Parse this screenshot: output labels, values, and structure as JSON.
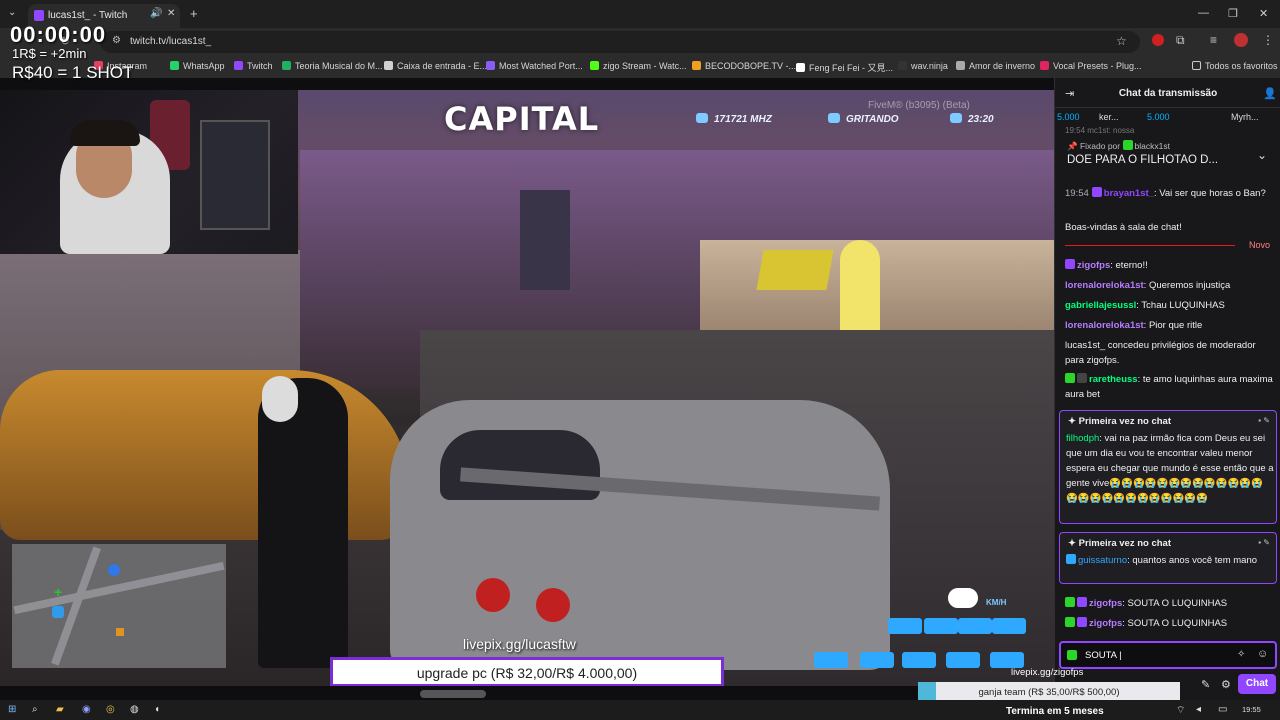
{
  "browser": {
    "tab_title": "lucas1st_ - Twitch",
    "tab_close": "✕",
    "new_tab": "+",
    "url": "twitch.tv/lucas1st_",
    "bookmarks": [
      {
        "label": "Instagram",
        "color": "#e4405f"
      },
      {
        "label": "WhatsApp",
        "color": "#25d366"
      },
      {
        "label": "Twitch",
        "color": "#9146ff"
      },
      {
        "label": "Teoria Musical do M...",
        "color": "#20b060"
      },
      {
        "label": "Caixa de entrada - E...",
        "color": "#d0d0d0"
      },
      {
        "label": "Most Watched Port...",
        "color": "#8a5cf6"
      },
      {
        "label": "zigo Stream - Watc...",
        "color": "#53fc18"
      },
      {
        "label": "BECODOBOPE.TV -...",
        "color": "#f0a020"
      },
      {
        "label": "Feng Fei Fei - 又見...",
        "color": "#ffffff"
      },
      {
        "label": "wav.ninja",
        "color": "#333333"
      },
      {
        "label": "Amor de inverno",
        "color": "#aaaaaa"
      },
      {
        "label": "Vocal Presets - Plug...",
        "color": "#e0245e"
      }
    ],
    "all_favorites": "Todos os favoritos"
  },
  "overlay": {
    "timer": "00:00:00",
    "rate_line1": "1R$ = +2min",
    "rate_line2": "R$40 = 1 SHOT"
  },
  "game": {
    "logo": "CAPITAL",
    "frequency": "171721 MHZ",
    "voice": "GRITANDO",
    "clock": "23:20",
    "fivem": "FiveM® (b3095) (Beta)",
    "speed_unit": "KM/H",
    "livepix": "livepix.gg/lucasftw",
    "goal": "upgrade pc (R$ 32,00/R$ 4.000,00)"
  },
  "chat": {
    "title": "Chat da transmissão",
    "leaderboard": [
      {
        "label": "5.000"
      },
      {
        "label": "ker..."
      },
      {
        "label": "5.000"
      },
      {
        "label": "Myrh..."
      }
    ],
    "behind_text": "19:54  mc1st: nossa",
    "pinned_by": "Fixado por",
    "pinned_user": "blackx1st",
    "pinned_text": "DOE PARA O FILHOTAO D...",
    "messages_top": [
      {
        "ts": "19:54",
        "user": "brayan1st_",
        "color": "#9147ff",
        "text": ": Vai ser que horas o Ban?"
      },
      {
        "ts": "",
        "user": "",
        "color": "#efeff1",
        "text": "Boas-vindas à sala de chat!"
      }
    ],
    "novo": "Novo",
    "messages": [
      {
        "user": "zigofps",
        "color": "#b77dff",
        "text": ": eterno!!"
      },
      {
        "user": "lorenalorelokа1st",
        "color": "#b77dff",
        "text": ": Queremos injustiça"
      },
      {
        "user": "gabriellajesussl",
        "color": "#00ff7f",
        "text": ": Tchau LUQUINHAS"
      },
      {
        "user": "lorenalorelokа1st",
        "color": "#b77dff",
        "text": ": Pior que ritle"
      },
      {
        "user": "",
        "color": "#efeff1",
        "text": "lucas1st_ concedeu privilégios de moderador para zigofps."
      },
      {
        "user": "raretheuss",
        "color": "#00ff7f",
        "text": ": te amo luquinhas aura maxima aura bet"
      }
    ],
    "first_title": "Primeira vez no chat",
    "first1_user": "filhodph",
    "first1_text": ": vai na paz irmão fica com Deus eu sei que um dia eu vou te encontrar valeu menor espera eu chegar que mundo é esse então que a gente vive😭😭😭😭😭😭😭😭😭😭😭😭😭😭😭😭😭😭😭😭😭😭😭😭😭",
    "first2_user": "guissaturno",
    "first2_text": ": quantos anos você tem mano",
    "bottom_messages": [
      {
        "user": "zigofps",
        "color": "#b77dff",
        "text": ": SOUTA O LUQUINHAS"
      },
      {
        "user": "zigofps",
        "color": "#b77dff",
        "text": ": SOUTA O LUQUINHAS"
      }
    ],
    "input_value": "SOUTA |",
    "send_label": "Chat"
  },
  "stream_bottom": {
    "zigo_tag": "livepix.gg/zigofps",
    "team_goal": "ganja team (R$ 35,00/R$ 500,00)",
    "team_goal_progress": 0.07,
    "ends_in": "Termina em 5 meses"
  },
  "taskbar": {
    "clock": "19:55"
  }
}
